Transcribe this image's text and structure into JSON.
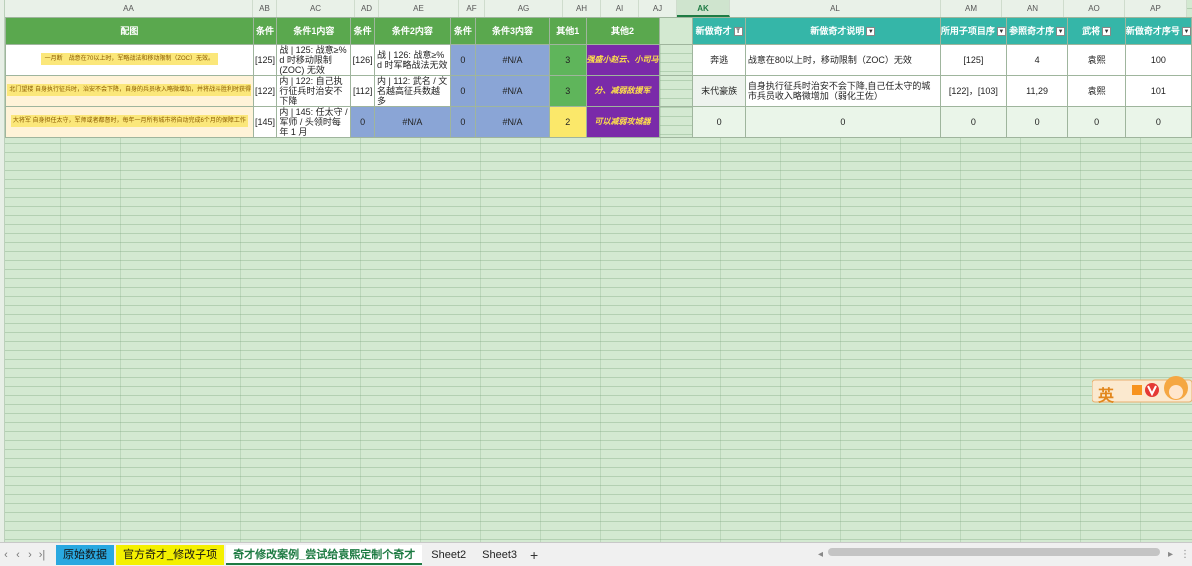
{
  "columns": [
    "AA",
    "AB",
    "AC",
    "AD",
    "AE",
    "AF",
    "AG",
    "AH",
    "AI",
    "AJ",
    "AK",
    "AL",
    "AM",
    "AN",
    "AO",
    "AP"
  ],
  "active_column": "AK",
  "headers": {
    "AA": "配图",
    "AB": "条件",
    "AC": "条件1内容",
    "AD": "条件",
    "AE": "条件2内容",
    "AF": "条件",
    "AG": "条件3内容",
    "AH": "其他1",
    "AI": "其他2",
    "AK": "新做奇才",
    "AL": "新做奇才说明",
    "AM": "所用子项目序",
    "AN": "参照奇才序",
    "AO": "武将",
    "AP": "新做奇才序号"
  },
  "rows": [
    {
      "img_text": "一月断　战意在70以上时，军略战法和移动限制（ZOC）无效。",
      "ab": "[125]",
      "ac": "战 | 125: 战意≥% d 时移动限制 (ZOC) 无效",
      "ad": "[126]",
      "ae": "战 | 126: 战意≥% d 时军略战法无效",
      "af": "0",
      "ag": "#N/A",
      "ah": "3",
      "ai": "强盛小赵云、小司马",
      "ak": "奔逃",
      "al": "战意在80以上时，移动限制（ZOC）无效",
      "am": "[125]",
      "an": "4",
      "ao": "袁熙",
      "ap": "100"
    },
    {
      "img_text": "北门望楼 自身执行征兵时，治安不会下降，自身的兵员收入略微增加，并将战斗胜利时获得兵员",
      "ab": "[122]",
      "ac": "内 | 122: 自己执行征兵时治安不下降",
      "ad": "[112]",
      "ae": "内 | 112: 武名 / 文名越高征兵数越多",
      "af": "0",
      "ag": "#N/A",
      "ah": "3",
      "ai": "分、减弱敌援军",
      "ak": "末代豪族",
      "al": "自身执行征兵时治安不会下降,自己任太守的城市兵员收入略微增加（弱化王佐）",
      "am": "[122]，[103]",
      "an": "11,29",
      "ao": "袁熙",
      "ap": "101"
    },
    {
      "img_text": "大将军 自身担任太守，军师或者都督时，每年一月所有城市将自动完成6个月的保障工作",
      "ab": "[145]",
      "ac": "内 | 145: 任太守 / 军师 / 头领时每年 1 月",
      "ad": "0",
      "ae": "#N/A",
      "af": "0",
      "ag": "#N/A",
      "ah": "2",
      "ai": "可以减弱攻城器",
      "ak": "0",
      "al": "0",
      "am": "0",
      "an": "0",
      "ao": "0",
      "ap": "0"
    }
  ],
  "sheet_tabs": [
    {
      "label": "原始数据",
      "style": "blue"
    },
    {
      "label": "官方奇才_修改子项",
      "style": "yellow"
    },
    {
      "label": "奇才修改案例_尝试给袁熙定制个奇才",
      "style": "active"
    },
    {
      "label": "Sheet2",
      "style": "plain"
    },
    {
      "label": "Sheet3",
      "style": "plain"
    }
  ],
  "add_sheet": "+",
  "sticker_text": "英",
  "colors": {
    "header_green": "#5aa84e",
    "header_teal": "#35b6a8",
    "grid_bg": "#d3e9d1"
  }
}
